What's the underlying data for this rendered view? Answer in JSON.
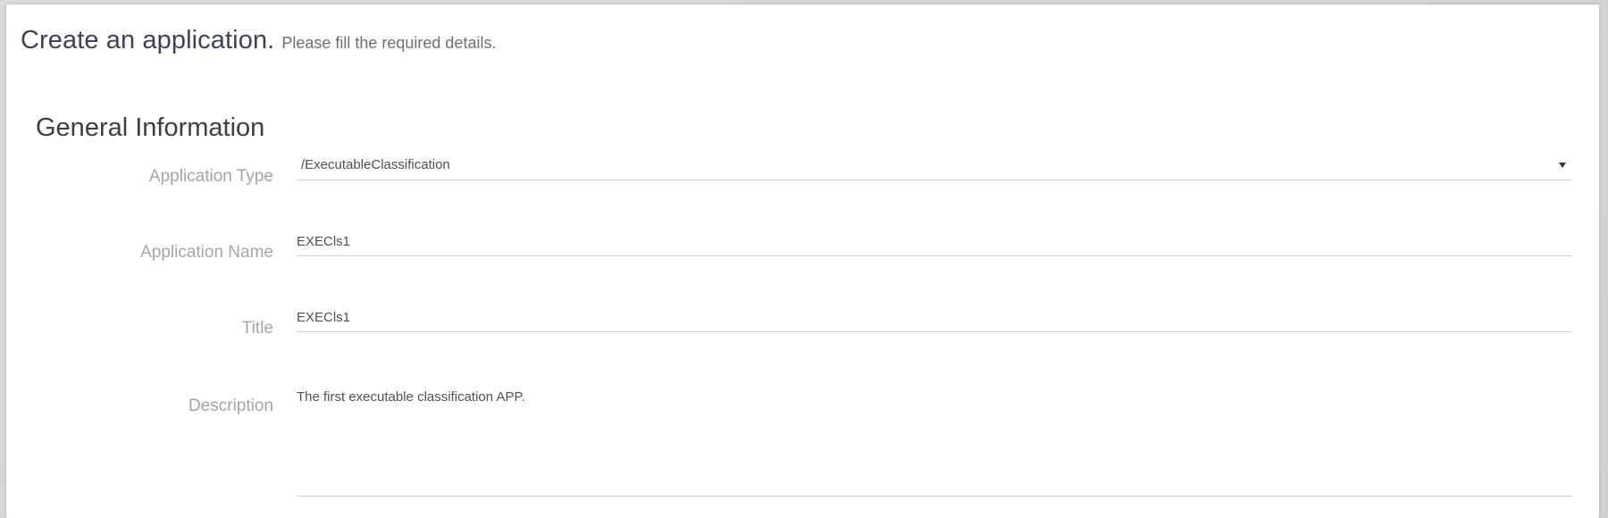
{
  "page": {
    "title": "Create an application.",
    "subtitle": "Please fill the required details."
  },
  "section": {
    "title": "General Information"
  },
  "form": {
    "application_type": {
      "label": "Application Type",
      "value": "/ExecutableClassification"
    },
    "application_name": {
      "label": "Application Name",
      "value": "EXECls1"
    },
    "title": {
      "label": "Title",
      "value": "EXECls1"
    },
    "description": {
      "label": "Description",
      "value": "The first executable classification APP."
    }
  },
  "icons": {
    "dropdown": "chevron-down-icon"
  },
  "colors": {
    "page_background": "#d7d7d7",
    "card_background": "#ffffff",
    "title_text": "#3f4454",
    "label_text": "#a5a5a5",
    "input_text": "#515151",
    "field_border": "#cfcfcf"
  }
}
